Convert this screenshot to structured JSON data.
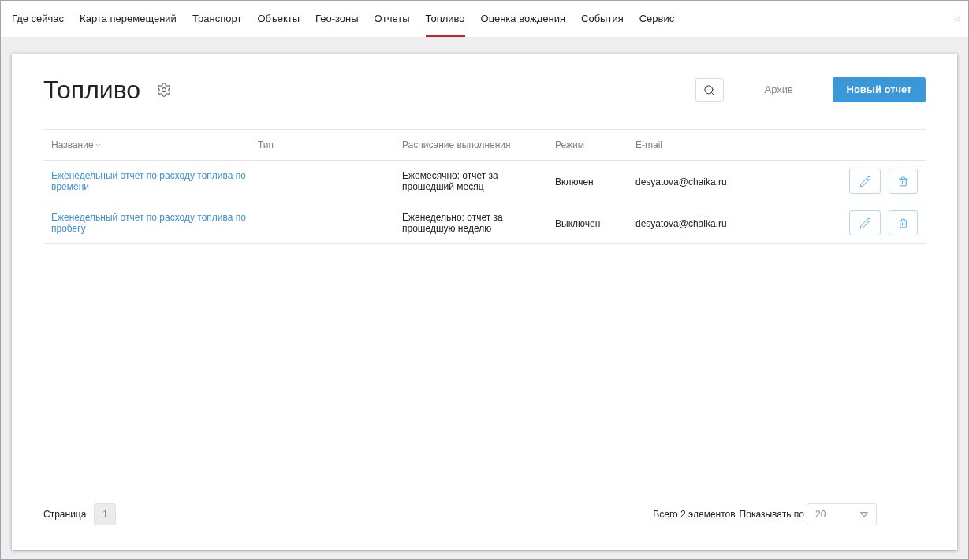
{
  "nav": {
    "tabs": [
      {
        "label": "Где сейчас",
        "selected": false
      },
      {
        "label": "Карта перемещений",
        "selected": false
      },
      {
        "label": "Транспорт",
        "selected": false
      },
      {
        "label": "Объекты",
        "selected": false
      },
      {
        "label": "Гео-зоны",
        "selected": false
      },
      {
        "label": "Отчеты",
        "selected": false
      },
      {
        "label": "Топливо",
        "selected": true
      },
      {
        "label": "Оценка вождения",
        "selected": false
      },
      {
        "label": "События",
        "selected": false
      },
      {
        "label": "Сервис",
        "selected": false
      }
    ]
  },
  "header": {
    "title": "Топливо",
    "archive_link": "Архив",
    "new_button": "Новый отчет"
  },
  "table": {
    "columns": [
      {
        "label": "Название",
        "sorted": true
      },
      {
        "label": "Тип",
        "sorted": false
      },
      {
        "label": "Расписание выполнения",
        "sorted": false
      },
      {
        "label": "Режим",
        "sorted": false
      },
      {
        "label": "E-mail",
        "sorted": false
      }
    ],
    "rows": [
      {
        "name": "Еженедельный отчет по расходу топлива по времени",
        "schedule": "Ежемесячно: отчет за прошедший месяц",
        "mode": "Включен",
        "email": "desyatova@chaika.ru"
      },
      {
        "name": "Еженедельный отчет по расходу топлива по пробегу",
        "schedule": "Еженедельно: отчет за прошедшую неделю",
        "mode": "Выключен",
        "email": "desyatova@chaika.ru"
      }
    ]
  },
  "footer": {
    "page_label": "Страница",
    "pages": [
      {
        "label": "1",
        "selected": true
      }
    ],
    "total": "Всего 2 элементов",
    "page_size_label": "Показывать по",
    "page_size": "20"
  }
}
